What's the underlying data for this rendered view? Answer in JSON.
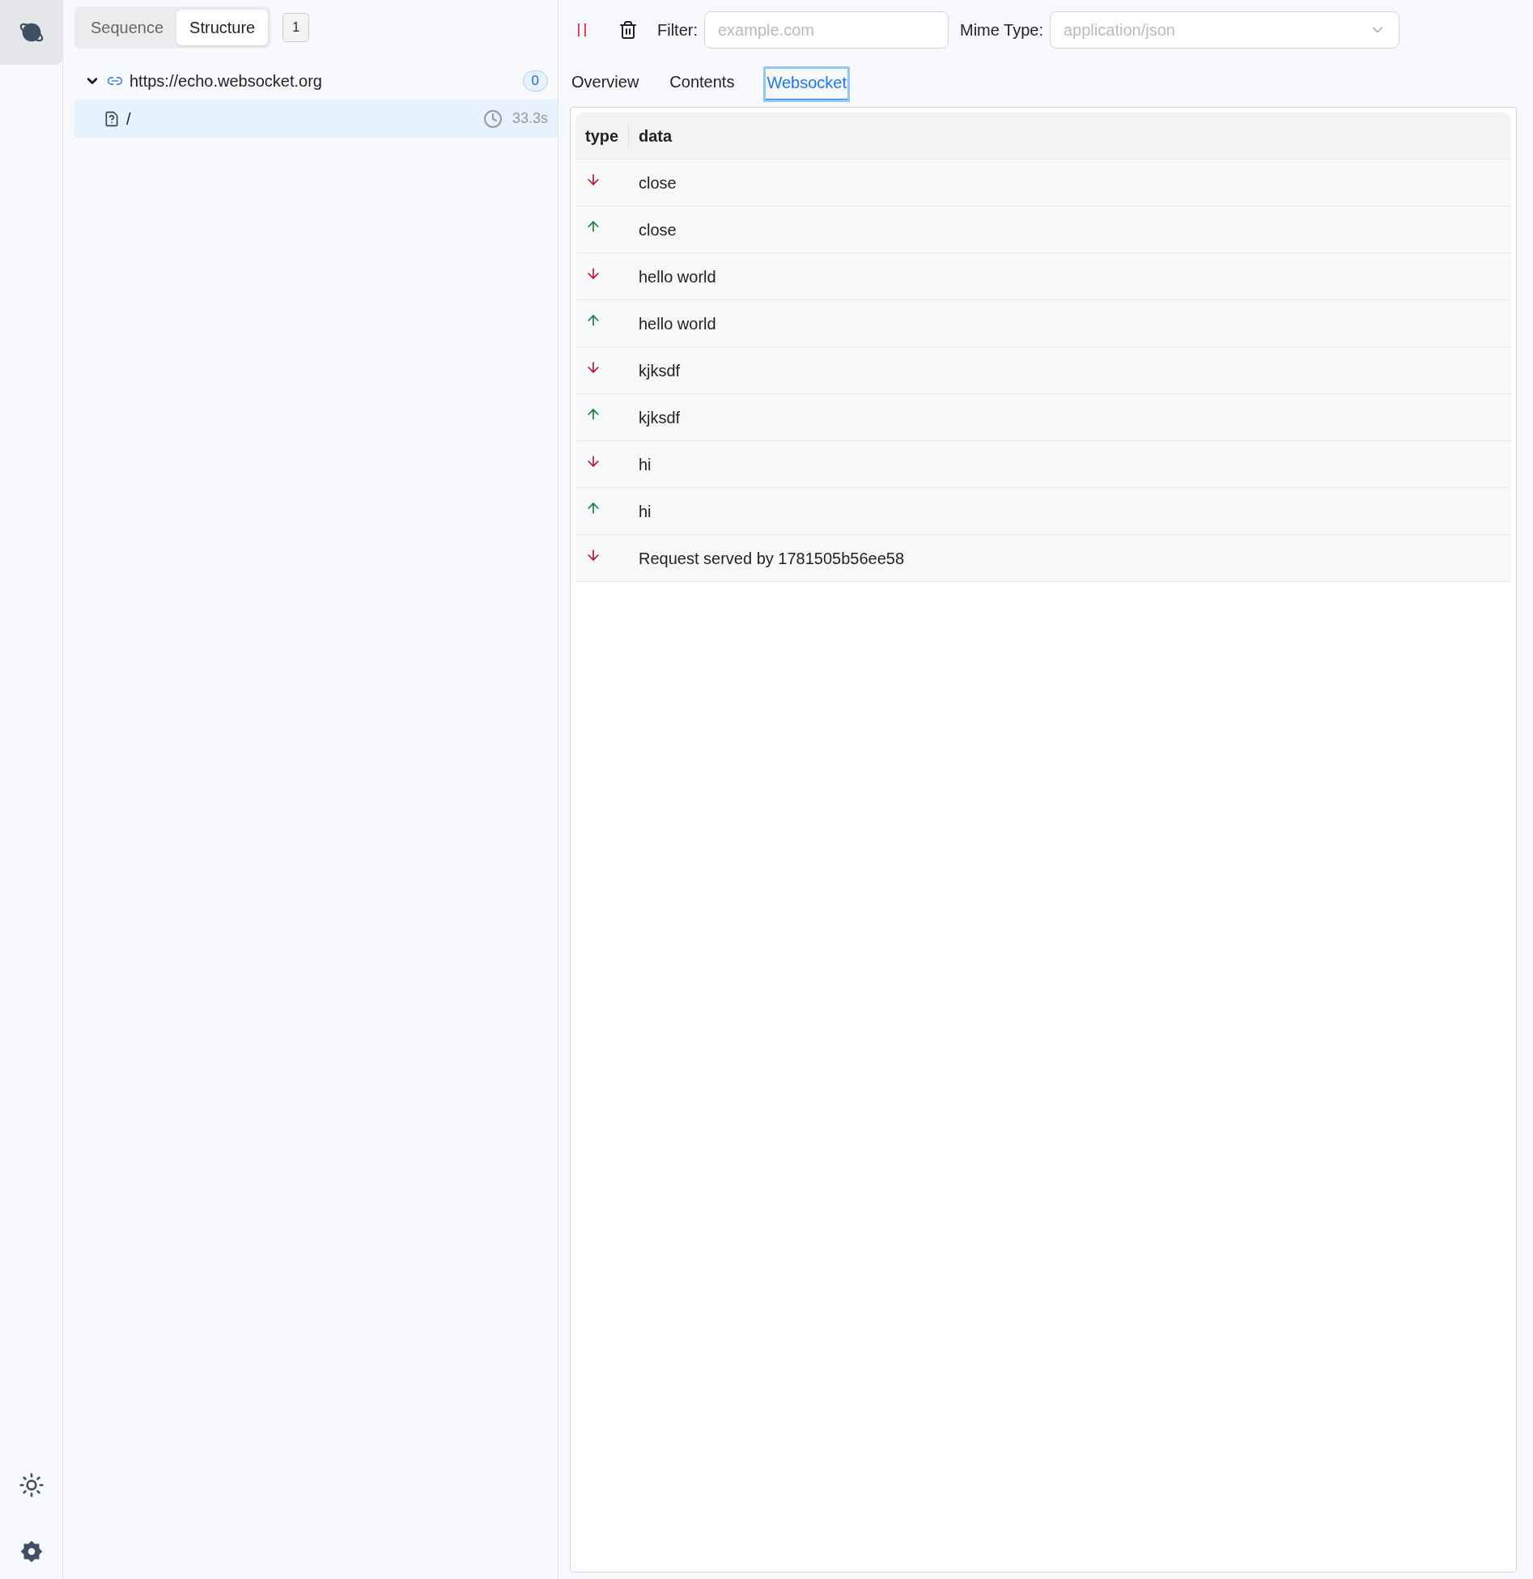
{
  "view_toggle": [
    {
      "label": "Sequence",
      "selected": false
    },
    {
      "label": "Structure",
      "selected": true
    }
  ],
  "request_count": "1",
  "tree": [
    {
      "label": "https://echo.websocket.org",
      "count": "0",
      "expanded": true,
      "selected": false,
      "children": [
        {
          "label": "/",
          "duration": "33.3s",
          "selected": true
        }
      ]
    }
  ],
  "toolbar": {
    "filter": {
      "label": "Filter:",
      "placeholder": "example.com"
    },
    "mime_type": {
      "label": "Mime Type:",
      "placeholder": "application/json"
    }
  },
  "tabs": [
    {
      "label": "Overview",
      "selected": false
    },
    {
      "label": "Contents",
      "selected": false
    },
    {
      "label": "Websocket",
      "selected": true
    }
  ],
  "table": {
    "columns": [
      "type",
      "data"
    ],
    "rows": [
      {
        "kind": "down",
        "data": "close"
      },
      {
        "kind": "up",
        "data": "close"
      },
      {
        "kind": "down",
        "data": "hello world"
      },
      {
        "kind": "up",
        "data": "hello world"
      },
      {
        "kind": "down",
        "data": "kjksdf"
      },
      {
        "kind": "up",
        "data": "kjksdf"
      },
      {
        "kind": "down",
        "data": "hi"
      },
      {
        "kind": "up",
        "data": "hi"
      },
      {
        "kind": "down",
        "data": "Request served by 1781505b56ee58"
      }
    ]
  }
}
